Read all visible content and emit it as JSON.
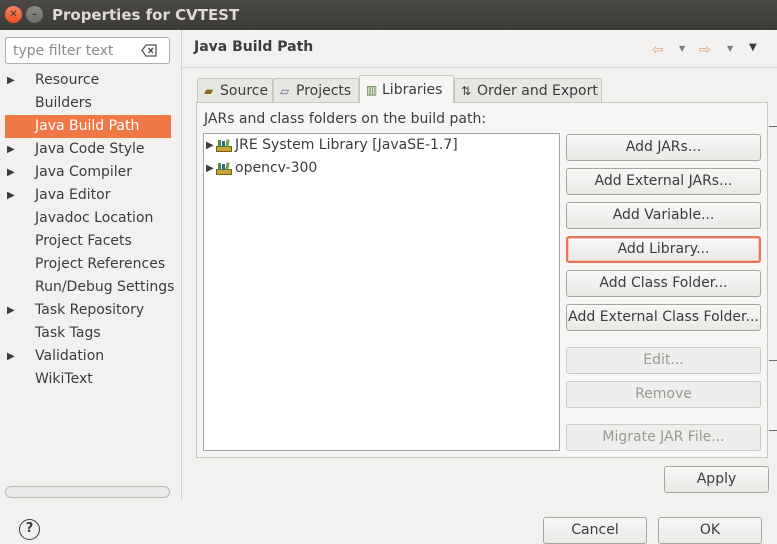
{
  "window": {
    "title": "Properties for CVTEST"
  },
  "filter": {
    "placeholder": "type filter text"
  },
  "nav": {
    "items": [
      {
        "label": "Resource",
        "expandable": true
      },
      {
        "label": "Builders",
        "expandable": false
      },
      {
        "label": "Java Build Path",
        "expandable": false,
        "selected": true
      },
      {
        "label": "Java Code Style",
        "expandable": true
      },
      {
        "label": "Java Compiler",
        "expandable": true
      },
      {
        "label": "Java Editor",
        "expandable": true
      },
      {
        "label": "Javadoc Location",
        "expandable": false
      },
      {
        "label": "Project Facets",
        "expandable": false
      },
      {
        "label": "Project References",
        "expandable": false
      },
      {
        "label": "Run/Debug Settings",
        "expandable": false
      },
      {
        "label": "Task Repository",
        "expandable": true
      },
      {
        "label": "Task Tags",
        "expandable": false
      },
      {
        "label": "Validation",
        "expandable": true
      },
      {
        "label": "WikiText",
        "expandable": false
      }
    ]
  },
  "header": {
    "title": "Java Build Path"
  },
  "tabs": [
    {
      "label": "Source",
      "icon": "source-folder-icon"
    },
    {
      "label": "Projects",
      "icon": "projects-folder-icon"
    },
    {
      "label": "Libraries",
      "icon": "libraries-icon",
      "active": true
    },
    {
      "label": "Order and Export",
      "icon": "order-export-icon"
    }
  ],
  "libraries": {
    "label": "JARs and class folders on the build path:",
    "entries": [
      {
        "label": "JRE System Library [JavaSE-1.7]"
      },
      {
        "label": "opencv-300"
      }
    ]
  },
  "buttons": {
    "add_jars": "Add JARs...",
    "add_external_jars": "Add External JARs...",
    "add_variable": "Add Variable...",
    "add_library": "Add Library...",
    "add_class_folder": "Add Class Folder...",
    "add_external_class_folder": "Add External Class Folder...",
    "edit": "Edit...",
    "remove": "Remove",
    "migrate_jar": "Migrate JAR File...",
    "apply": "Apply",
    "cancel": "Cancel",
    "ok": "OK"
  },
  "colors": {
    "accent": "#f07746",
    "titlebar": "#3c3b37",
    "close": "#e95420"
  }
}
